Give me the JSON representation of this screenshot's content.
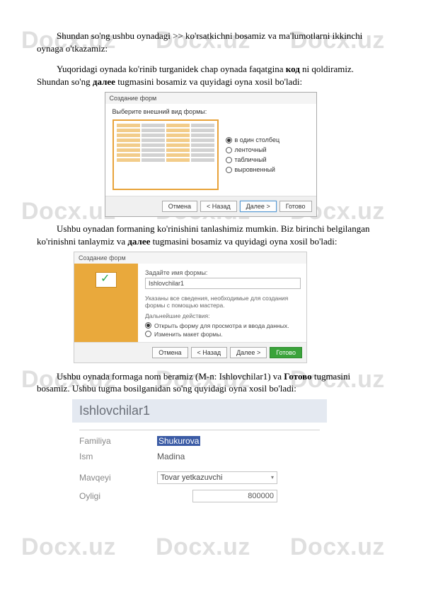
{
  "watermarks": {
    "text": "Docx.uz"
  },
  "para1": "Shundan so'ng ushbu oynadagi >> ko'rsatkichni bosamiz va ma'lumotlarni ikkinchi oynaga o'tkazamiz:",
  "para2_a": "Yuqoridagi oynada ko'rinib turganidek chap oynada faqatgina ",
  "para2_bold1": "код",
  "para2_b": " ni qoldiramiz. Shundan so'ng ",
  "para2_bold2": "далее",
  "para2_c": " tugmasini bosamiz va quyidagi oyna xosil bo'ladi:",
  "dlg1": {
    "header": "Создание форм",
    "sub": "Выберите внешний вид формы:",
    "opt1": "в один столбец",
    "opt2": "ленточный",
    "opt3": "табличный",
    "opt4": "выровненный",
    "btn_cancel": "Отмена",
    "btn_back": "< Назад",
    "btn_next": "Далее >",
    "btn_finish": "Готово"
  },
  "para3_a": "Ushbu oynadan formaning ko'rinishini tanlashimiz mumkin. Biz birinchi belgilangan ko'rinishni tanlaymiz va ",
  "para3_bold": "далее",
  "para3_b": " tugmasini bosamiz va quyidagi oyna xosil bo'ladi:",
  "dlg2": {
    "top": "Создание форм",
    "lbl": "Задайте имя формы:",
    "name": "Ishlovchilar1",
    "desc1": "Указаны все сведения, необходимые для создания формы с помощью мастера.",
    "desc2": "Дальнейшие действия:",
    "ropt1": "Открыть форму для просмотра и ввода данных.",
    "ropt2": "Изменить макет формы.",
    "btn_cancel": "Отмена",
    "btn_back": "< Назад",
    "btn_next": "Далее >",
    "btn_finish": "Готово"
  },
  "para4_a": "Ushbu oynada formaga nom beramiz (M-n: Ishlovchilar1) va ",
  "para4_bold": "Готово",
  "para4_b": " tugmasini bosamiz. Ushbu tugma bosilganidan so'ng quyidagi oyna xosil bo'ladi:",
  "form": {
    "title": "Ishlovchilar1",
    "f1_label": "Familiya",
    "f1_value": "Shukurova",
    "f2_label": "Ism",
    "f2_value": "Madina",
    "f3_label": "Mavqeyi",
    "f3_value": "Tovar yetkazuvchi",
    "f4_label": "Oyligi",
    "f4_value": "800000"
  }
}
